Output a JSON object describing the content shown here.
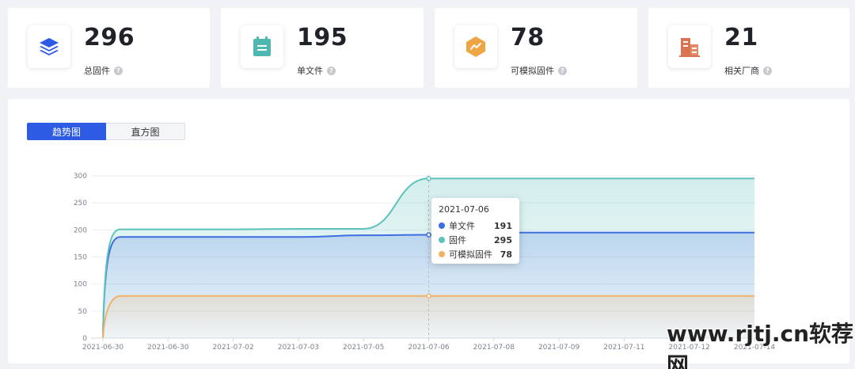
{
  "stats": [
    {
      "value": "296",
      "label": "总固件",
      "icon": "layers-icon",
      "color": "#2d5be3"
    },
    {
      "value": "195",
      "label": "单文件",
      "icon": "calendar-icon",
      "color": "#4fb6b0"
    },
    {
      "value": "78",
      "label": "可模拟固件",
      "icon": "hexagon-trend-icon",
      "color": "#f0a545"
    },
    {
      "value": "21",
      "label": "相关厂商",
      "icon": "building-icon",
      "color": "#d97452"
    }
  ],
  "help_glyph": "?",
  "tabs": {
    "trend": "趋势图",
    "histogram": "直方图"
  },
  "chart_data": {
    "type": "area",
    "x": [
      "2021-06-30",
      "2021-06-30",
      "2021-07-02",
      "2021-07-03",
      "2021-07-05",
      "2021-07-06",
      "2021-07-08",
      "2021-07-09",
      "2021-07-11",
      "2021-07-12",
      "2021-07-14"
    ],
    "ylim": [
      0,
      300
    ],
    "yticks": [
      0,
      50,
      100,
      150,
      200,
      250,
      300
    ],
    "series": [
      {
        "name": "单文件",
        "color": "#3e6fe0",
        "values": [
          187,
          187,
          187,
          187,
          190,
          191,
          195,
          195,
          195,
          195,
          195
        ]
      },
      {
        "name": "固件",
        "color": "#5fc3bd",
        "values": [
          201,
          201,
          201,
          202,
          202,
          295,
          295,
          295,
          295,
          295,
          295
        ]
      },
      {
        "name": "可模拟固件",
        "color": "#f2b266",
        "values": [
          78,
          78,
          78,
          78,
          78,
          78,
          78,
          78,
          78,
          78,
          78
        ]
      }
    ]
  },
  "tooltip": {
    "date": "2021-07-06",
    "rows": [
      {
        "name": "单文件",
        "value": "191",
        "color": "#3e6fe0"
      },
      {
        "name": "固件",
        "value": "295",
        "color": "#5fc3bd"
      },
      {
        "name": "可模拟固件",
        "value": "78",
        "color": "#f2b266"
      }
    ]
  },
  "watermark": "www.rjtj.cn软荐网"
}
